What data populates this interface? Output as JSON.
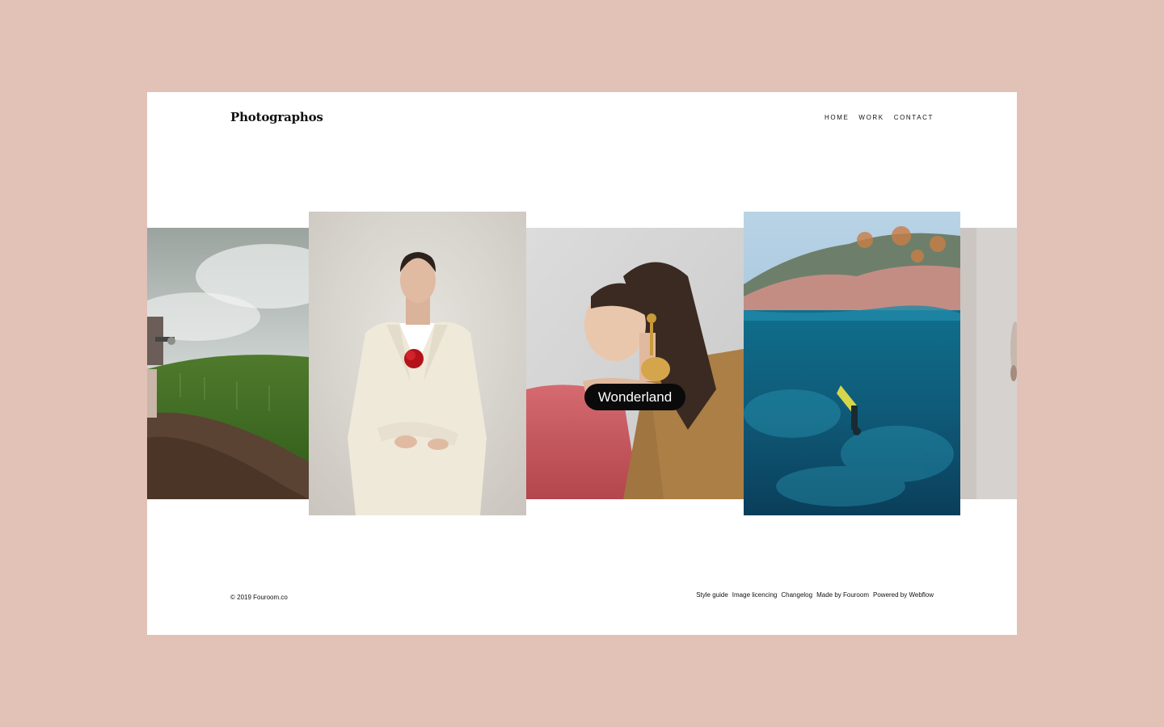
{
  "brand": {
    "name": "Photographos"
  },
  "nav": {
    "items": [
      "HOME",
      "WORK",
      "CONTACT"
    ]
  },
  "slider": {
    "active_caption": "Wonderland",
    "slides": [
      {
        "subject": "motocross-rider-in-field"
      },
      {
        "subject": "woman-in-cream-suit-with-red-flower"
      },
      {
        "subject": "woman-with-gold-earring-on-red-chair"
      },
      {
        "subject": "underwater-freediver"
      },
      {
        "subject": "partial-fashion-portrait"
      }
    ]
  },
  "footer": {
    "copyright": "© 2019 Fouroom.co",
    "links": [
      "Style guide",
      "Image licencing",
      "Changelog",
      "Made by Fouroom",
      "Powered by Webflow"
    ]
  },
  "colors": {
    "page_background": "#e2c1b7",
    "frame_background": "#ffffff",
    "tooltip_background": "#0a0a0a"
  }
}
